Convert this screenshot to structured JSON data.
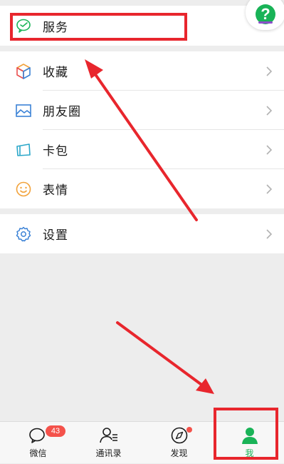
{
  "menu": {
    "service": "服务",
    "favorites": "收藏",
    "moments": "朋友圈",
    "cards": "卡包",
    "stickers": "表情",
    "settings": "设置"
  },
  "help": {
    "label": "?"
  },
  "tabbar": {
    "tabs": [
      {
        "label": "微信",
        "badge": "43"
      },
      {
        "label": "通讯录"
      },
      {
        "label": "发现",
        "dot": true
      },
      {
        "label": "我",
        "active": true
      }
    ]
  },
  "colors": {
    "accent": "#19b357",
    "annotation_red": "#e8262d",
    "badge_red": "#f4524b"
  }
}
